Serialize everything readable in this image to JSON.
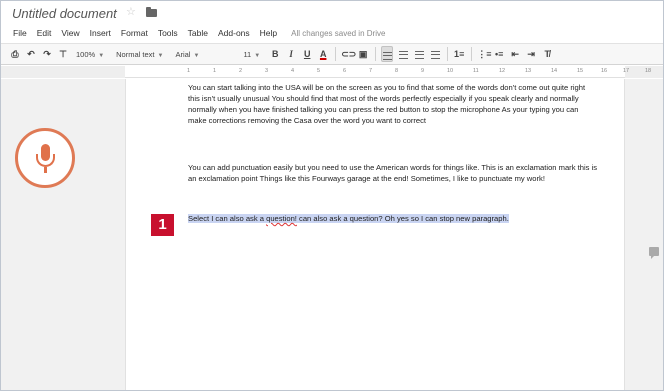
{
  "window": {
    "doc_title": "Untitled document",
    "saved_status": "All changes saved in Drive"
  },
  "menu": [
    "File",
    "Edit",
    "View",
    "Insert",
    "Format",
    "Tools",
    "Table",
    "Add-ons",
    "Help"
  ],
  "toolbar": {
    "zoom": "100%",
    "style": "Normal text",
    "font": "Arial",
    "size": "11",
    "bold": "B",
    "italic": "I",
    "underline": "U",
    "text_color": "A",
    "line_spacing": "1",
    "accent_color": "#c8102e"
  },
  "ruler": [
    "1",
    "1",
    "2",
    "3",
    "4",
    "5",
    "6",
    "7",
    "8",
    "9",
    "10",
    "11",
    "12",
    "13",
    "14",
    "15",
    "16",
    "17",
    "18"
  ],
  "document": {
    "p1": "You can start talking into the USA will be on the screen as you to find that some of the words don't come out quite right this isn't usually unusual You should find that most of the words perfectly especially if you speak clearly and normally normally when you have finished talking you can press the red button to stop the microphone As your typing you can make corrections removing the Casa over the word you want to correct",
    "p2": "You can add punctuation easily but you need to use the American words for things like. This is an exclamation mark this is an exclamation point Things like this Fourways garage at the end! Sometimes, I like to punctuate my work!",
    "p3_a": "Select I can also ask a ",
    "p3_word": "question!",
    "p3_b": " can also ask a question? Oh yes so I can stop new paragraph."
  },
  "badge": {
    "number": "1"
  },
  "icons": {
    "mic": "microphone-icon",
    "star": "star-icon",
    "folder": "folder-icon",
    "comment": "add-comment-icon"
  },
  "colors": {
    "mic": "#e0714a",
    "selection": "#c9d4f2",
    "badge": "#c8102e"
  }
}
